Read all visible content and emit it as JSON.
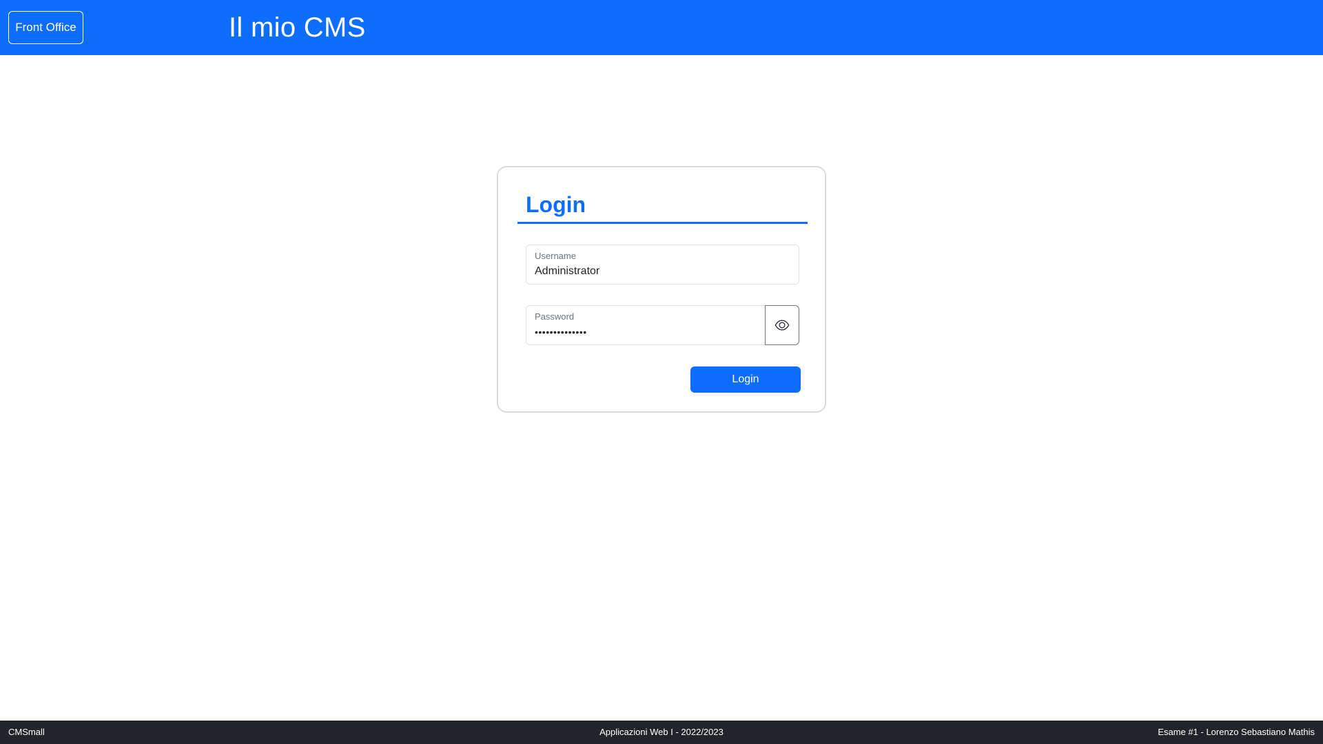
{
  "header": {
    "front_office_label": "Front Office",
    "title": "Il mio CMS",
    "background_color": "#0d6efd"
  },
  "login": {
    "heading": "Login",
    "username": {
      "label": "Username",
      "value": "Administrator"
    },
    "password": {
      "label": "Password",
      "value": "••••••••••••••",
      "toggle_icon": "eye-icon"
    },
    "submit_label": "Login",
    "accent_color": "#0d6efd"
  },
  "footer": {
    "left": "CMSmall",
    "center": "Applicazioni Web I - 2022/2023",
    "right": "Esame #1 - Lorenzo Sebastiano Mathis",
    "background_color": "#212529"
  }
}
